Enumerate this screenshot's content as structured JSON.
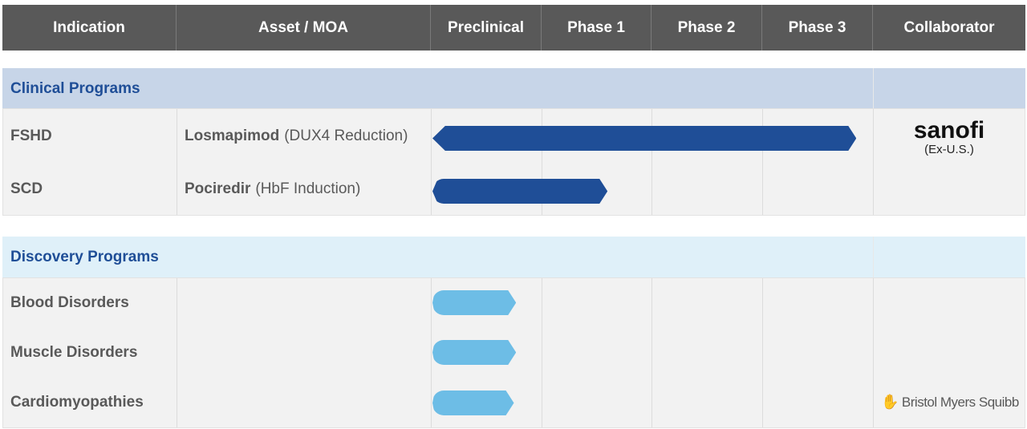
{
  "header": [
    "Indication",
    "Asset / MOA",
    "Preclinical",
    "Phase 1",
    "Phase 2",
    "Phase 3",
    "Collaborator"
  ],
  "colors": {
    "header_bg": "#595959",
    "clinical_bar": "#1f4e97",
    "discovery_bar": "#6dbde6",
    "section_title": "#1f4e97"
  },
  "clinical": {
    "title": "Clinical Programs",
    "rows": [
      {
        "indication": "FSHD",
        "asset": "Losmapimod",
        "moa": "(DUX4 Reduction)",
        "progress_phases": 3.85,
        "collaborator": "sanofi",
        "collaborator_note": "(Ex-U.S.)"
      },
      {
        "indication": "SCD",
        "asset": "Pociredir",
        "moa": "(HbF Induction)",
        "progress_phases": 1.6
      }
    ]
  },
  "discovery": {
    "title": "Discovery Programs",
    "rows": [
      {
        "indication": "Blood Disorders",
        "progress_phases": 0.77
      },
      {
        "indication": "Muscle Disorders",
        "progress_phases": 0.77
      },
      {
        "indication": "Cardiomyopathies",
        "progress_phases": 0.75,
        "collaborator": "Bristol Myers Squibb"
      }
    ]
  }
}
